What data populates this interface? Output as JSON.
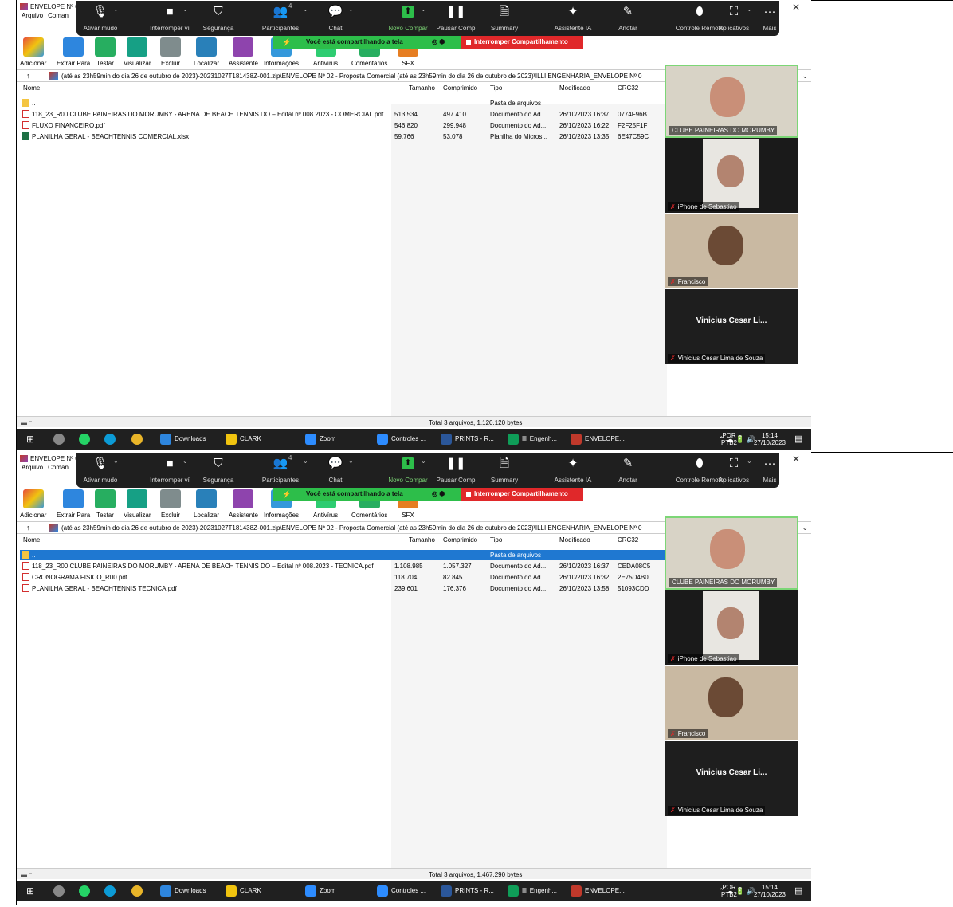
{
  "shots": [
    {
      "window_title": "ENVELOPE Nº 0",
      "menu": [
        "Arquivo",
        "Coman"
      ],
      "zoom_toolbar": [
        {
          "label": "Ativar mudo",
          "icon": "microphone-icon",
          "glyph": "🎙"
        },
        {
          "label": "Interromper ví",
          "icon": "video-camera-icon",
          "glyph": "■"
        },
        {
          "label": "Segurança",
          "icon": "shield-icon",
          "glyph": "⛉"
        },
        {
          "label": "Participantes",
          "icon": "participants-icon",
          "glyph": "👥",
          "badge": "4"
        },
        {
          "label": "Chat",
          "icon": "chat-icon",
          "glyph": "💬"
        },
        {
          "label": "Novo Compar",
          "icon": "share-screen-icon",
          "glyph": "⬆"
        },
        {
          "label": "Pausar Comp",
          "icon": "pause-icon",
          "glyph": "❚❚"
        },
        {
          "label": "Summary",
          "icon": "summary-icon",
          "glyph": "🗎"
        },
        {
          "label": "Assistente IA",
          "icon": "ai-sparkle-icon",
          "glyph": "✦"
        },
        {
          "label": "Anotar",
          "icon": "pencil-icon",
          "glyph": "✎"
        },
        {
          "label": "Controle Remoto",
          "icon": "mouse-icon",
          "glyph": "⬮"
        },
        {
          "label": "Aplicativos",
          "icon": "apps-icon",
          "glyph": "⛶"
        },
        {
          "label": "Mais",
          "icon": "more-icon",
          "glyph": "···"
        }
      ],
      "share_banner": "Você está compartilhando a tela",
      "stop_share": "Interromper Compartilhamento",
      "toolbar": [
        "Adicionar",
        "Extrair Para",
        "Testar",
        "Visualizar",
        "Excluir",
        "Localizar",
        "Assistente",
        "Informações",
        "Antivírus",
        "Comentários",
        "SFX"
      ],
      "address": "(até as 23h59min do dia 26 de outubro de 2023)-20231027T181438Z-001.zip\\ENVELOPE Nº 02 - Proposta Comercial (até as 23h59min do dia 26 de outubro de 2023)\\ILLI ENGENHARIA_ENVELOPE Nº 0",
      "columns": {
        "name": "Nome",
        "size": "Tamanho",
        "packed": "Comprimido",
        "type": "Tipo",
        "modified": "Modificado",
        "crc": "CRC32"
      },
      "rows": [
        {
          "name": "..",
          "size": "",
          "packed": "",
          "type": "Pasta de arquivos",
          "modified": "",
          "crc": "",
          "kind": "folder",
          "selected": false
        },
        {
          "name": "118_23_R00 CLUBE PAINEIRAS DO MORUMBY - ARENA DE BEACH TENNIS DO  – Edital nº 008.2023 - COMERCIAL.pdf",
          "size": "513.534",
          "packed": "497.410",
          "type": "Documento do Ad...",
          "modified": "26/10/2023 16:37",
          "crc": "0774F96B",
          "kind": "pdf",
          "selected": false
        },
        {
          "name": "FLUXO FINANCEIRO.pdf",
          "size": "546.820",
          "packed": "299.948",
          "type": "Documento do Ad...",
          "modified": "26/10/2023 16:22",
          "crc": "F2F25F1F",
          "kind": "pdf",
          "selected": false
        },
        {
          "name": "PLANILHA GERAL - BEACHTENNIS COMERCIAL.xlsx",
          "size": "59.766",
          "packed": "53.078",
          "type": "Planilha do Micros...",
          "modified": "26/10/2023 13:35",
          "crc": "6E47C59C",
          "kind": "xlsx",
          "selected": false
        }
      ],
      "status": "Total 3 arquivos, 1.120.120 bytes",
      "participants": [
        {
          "name": "CLUBE PAINEIRAS DO MORUMBY",
          "muted": false
        },
        {
          "name": "iPhone de Sebastiao",
          "muted": true
        },
        {
          "name": "Francisco",
          "muted": true
        },
        {
          "name": "Vinicius Cesar Lima de Souza",
          "big": "Vinicius Cesar Li...",
          "muted": true
        }
      ],
      "taskbar": [
        "Downloads",
        "CLARK",
        "Zoom",
        "Controles ...",
        "PRINTS - R...",
        "Illi Engenh...",
        "ENVELOPE..."
      ],
      "tray_lang": "POR",
      "tray_layout": "PTB2",
      "time": "15:14",
      "date": "27/10/2023"
    },
    {
      "window_title": "ENVELOPE Nº 0",
      "menu": [
        "Arquivo",
        "Coman"
      ],
      "zoom_toolbar": [
        {
          "label": "Ativar mudo",
          "icon": "microphone-icon",
          "glyph": "🎙"
        },
        {
          "label": "Interromper ví",
          "icon": "video-camera-icon",
          "glyph": "■"
        },
        {
          "label": "Segurança",
          "icon": "shield-icon",
          "glyph": "⛉"
        },
        {
          "label": "Participantes",
          "icon": "participants-icon",
          "glyph": "👥",
          "badge": "4"
        },
        {
          "label": "Chat",
          "icon": "chat-icon",
          "glyph": "💬"
        },
        {
          "label": "Novo Compar",
          "icon": "share-screen-icon",
          "glyph": "⬆"
        },
        {
          "label": "Pausar Comp",
          "icon": "pause-icon",
          "glyph": "❚❚"
        },
        {
          "label": "Summary",
          "icon": "summary-icon",
          "glyph": "🗎"
        },
        {
          "label": "Assistente IA",
          "icon": "ai-sparkle-icon",
          "glyph": "✦"
        },
        {
          "label": "Anotar",
          "icon": "pencil-icon",
          "glyph": "✎"
        },
        {
          "label": "Controle Remoto",
          "icon": "mouse-icon",
          "glyph": "⬮"
        },
        {
          "label": "Aplicativos",
          "icon": "apps-icon",
          "glyph": "⛶"
        },
        {
          "label": "Mais",
          "icon": "more-icon",
          "glyph": "···"
        }
      ],
      "share_banner": "Você está compartilhando a tela",
      "stop_share": "Interromper Compartilhamento",
      "toolbar": [
        "Adicionar",
        "Extrair Para",
        "Testar",
        "Visualizar",
        "Excluir",
        "Localizar",
        "Assistente",
        "Informações",
        "Antivírus",
        "Comentários",
        "SFX"
      ],
      "address": "(até as 23h59min do dia 26 de outubro de 2023)-20231027T181438Z-001.zip\\ENVELOPE Nº 02 - Proposta Comercial (até as 23h59min do dia 26 de outubro de 2023)\\ILLI ENGENHARIA_ENVELOPE Nº 0",
      "columns": {
        "name": "Nome",
        "size": "Tamanho",
        "packed": "Comprimido",
        "type": "Tipo",
        "modified": "Modificado",
        "crc": "CRC32"
      },
      "rows": [
        {
          "name": "..",
          "size": "",
          "packed": "",
          "type": "Pasta de arquivos",
          "modified": "",
          "crc": "",
          "kind": "folder",
          "selected": true
        },
        {
          "name": "118_23_R00 CLUBE PAINEIRAS DO MORUMBY - ARENA DE BEACH TENNIS DO  – Edital nº 008.2023 - TECNICA.pdf",
          "size": "1.108.985",
          "packed": "1.057.327",
          "type": "Documento do Ad...",
          "modified": "26/10/2023 16:37",
          "crc": "CEDA08C5",
          "kind": "pdf",
          "selected": false
        },
        {
          "name": "CRONOGRAMA FISICO_R00.pdf",
          "size": "118.704",
          "packed": "82.845",
          "type": "Documento do Ad...",
          "modified": "26/10/2023 16:32",
          "crc": "2E75D4B0",
          "kind": "pdf",
          "selected": false
        },
        {
          "name": "PLANILHA GERAL - BEACHTENNIS TECNICA.pdf",
          "size": "239.601",
          "packed": "176.376",
          "type": "Documento do Ad...",
          "modified": "26/10/2023 13:58",
          "crc": "51093CDD",
          "kind": "pdf",
          "selected": false
        }
      ],
      "status": "Total 3 arquivos, 1.467.290 bytes",
      "participants": [
        {
          "name": "CLUBE PAINEIRAS DO MORUMBY",
          "muted": false
        },
        {
          "name": "iPhone de Sebastiao",
          "muted": true
        },
        {
          "name": "Francisco",
          "muted": true
        },
        {
          "name": "Vinicius Cesar Lima de Souza",
          "big": "Vinicius Cesar Li...",
          "muted": true
        }
      ],
      "taskbar": [
        "Downloads",
        "CLARK",
        "Zoom",
        "Controles ...",
        "PRINTS - R...",
        "Illi Engenh...",
        "ENVELOPE..."
      ],
      "tray_lang": "POR",
      "tray_layout": "PTB2",
      "time": "15:14",
      "date": "27/10/2023"
    }
  ]
}
